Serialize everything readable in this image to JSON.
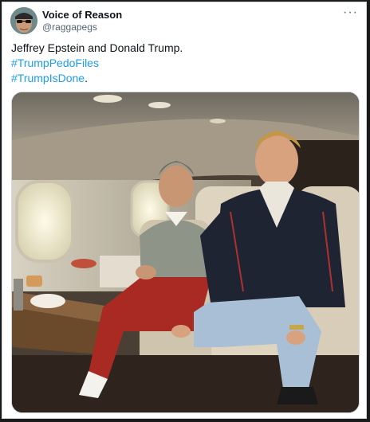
{
  "author": {
    "display_name": "Voice of Reason",
    "handle": "@raggapegs"
  },
  "more_label": "···",
  "tweet": {
    "text_line1": "Jeffrey Epstein and Donald Trump.",
    "hashtags": [
      "#TrumpPedoFiles",
      "#TrumpIsDone"
    ],
    "trailing_period": "."
  },
  "colors": {
    "link": "#1d9bf0",
    "text": "#0f1419",
    "secondary": "#536471"
  },
  "icons": {
    "more": "ellipsis-icon",
    "avatar": "avatar-image"
  }
}
